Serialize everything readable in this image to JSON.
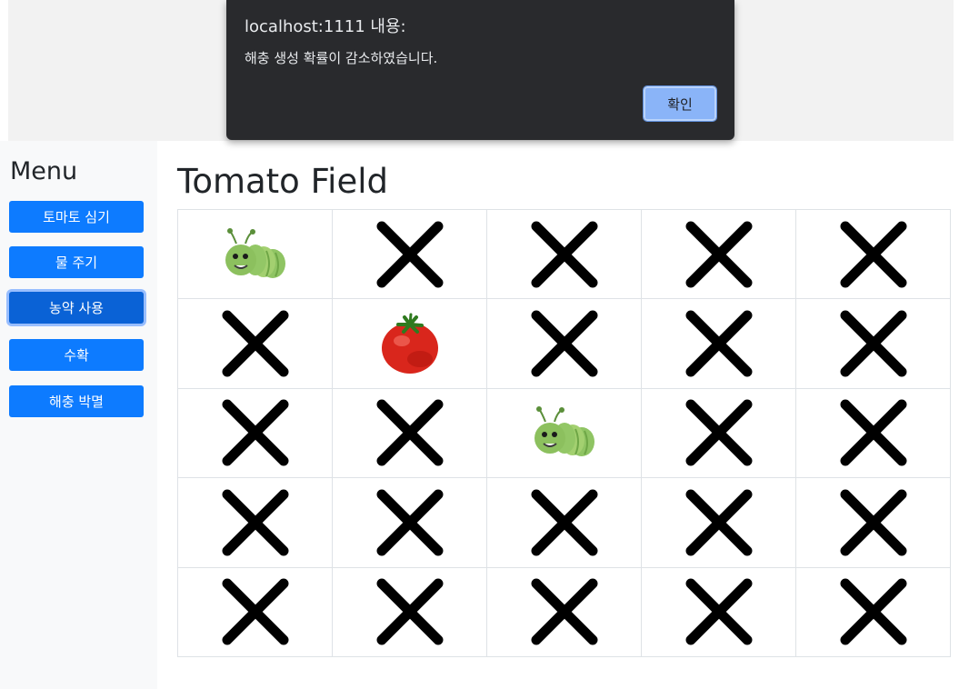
{
  "dialog": {
    "title": "localhost:1111 내용:",
    "message": "해충 생성 확률이 감소하였습니다.",
    "ok_label": "확인"
  },
  "sidebar": {
    "title": "Menu",
    "buttons": [
      {
        "label": "토마토 심기"
      },
      {
        "label": "물 주기"
      },
      {
        "label": "농약 사용",
        "active": true
      },
      {
        "label": "수확"
      },
      {
        "label": "해충 박멸"
      }
    ]
  },
  "main": {
    "title": "Tomato Field"
  },
  "field": {
    "rows": [
      [
        "pest",
        "empty",
        "empty",
        "empty",
        "empty"
      ],
      [
        "empty",
        "tomato",
        "empty",
        "empty",
        "empty"
      ],
      [
        "empty",
        "empty",
        "pest",
        "empty",
        "empty"
      ],
      [
        "empty",
        "empty",
        "empty",
        "empty",
        "empty"
      ],
      [
        "empty",
        "empty",
        "empty",
        "empty",
        "empty"
      ]
    ]
  },
  "colors": {
    "button": "#0d7bff",
    "button_active": "#0a62d6",
    "dialog_bg": "#292a2d",
    "dialog_ok": "#8ab4f8"
  }
}
